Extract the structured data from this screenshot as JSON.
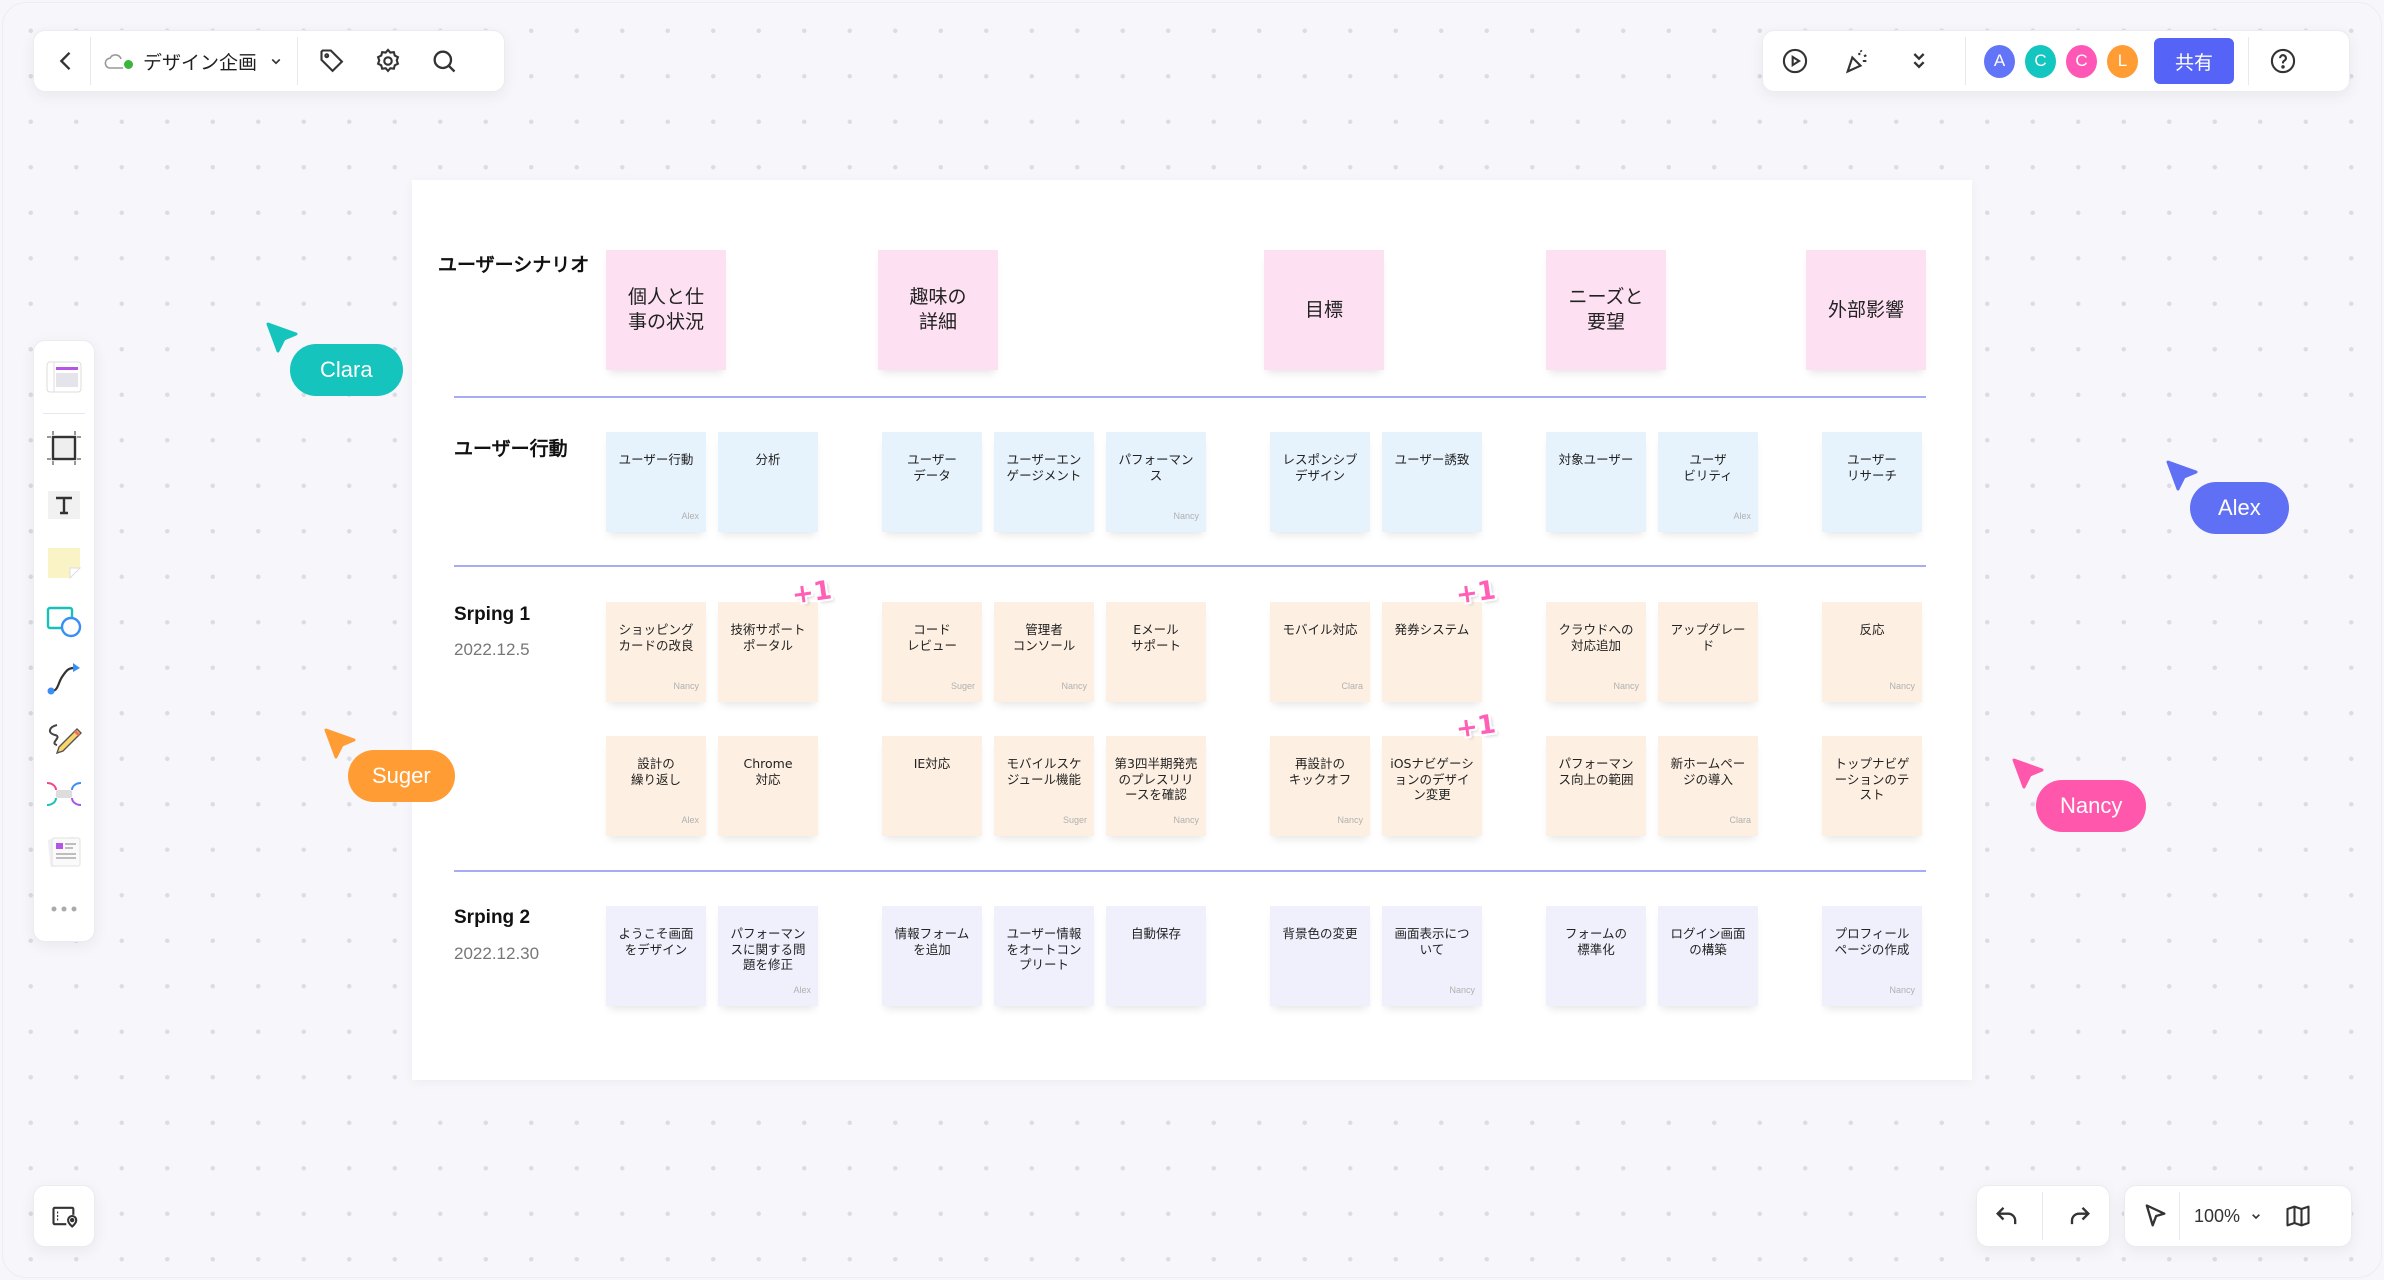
{
  "toolbar": {
    "back_icon": "chevron-left-icon",
    "doc_title": "デザイン企画",
    "sync_status": "synced",
    "icons": [
      "tag-icon",
      "settings-icon",
      "search-icon"
    ]
  },
  "top_right": {
    "icons": [
      "play-icon",
      "celebrate-icon",
      "double-chevron-down-icon",
      "help-icon"
    ],
    "collaborators": [
      {
        "initial": "A",
        "color": "#6274f7"
      },
      {
        "initial": "C",
        "color": "#13c6bf"
      },
      {
        "initial": "C",
        "color": "#ff57b6"
      },
      {
        "initial": "L",
        "color": "#ff9c33"
      }
    ],
    "share_label": "共有",
    "share_color": "#5563f6"
  },
  "left_toolbar": {
    "tools": [
      "template-icon",
      "frame-icon",
      "text-icon",
      "sticky-note-icon",
      "shape-icon",
      "connector-icon",
      "pen-icon",
      "mindmap-icon",
      "document-icon",
      "more-icon"
    ]
  },
  "bottom": {
    "outline_icon": "outline-icon",
    "zoom_level": "100%",
    "icons": [
      "undo-icon",
      "redo-icon",
      "select-cursor-icon",
      "map-icon"
    ]
  },
  "board": {
    "colors": {
      "scenario": "#fde1f3",
      "action": "#e6f3fd",
      "sprint1": "#fdf0e2",
      "sprint2": "#f0f0fd",
      "separator": "#a6abf2"
    },
    "rows": {
      "scenario": {
        "title": "ユーザーシナリオ"
      },
      "action": {
        "title": "ユーザー行動"
      },
      "sprint1": {
        "title": "Srping 1",
        "date": "2022.12.5"
      },
      "sprint2": {
        "title": "Srping 2",
        "date": "2022.12.30"
      }
    },
    "scenario_stickies": [
      {
        "text": "個人と仕\n事の状況"
      },
      {
        "text": "趣味の\n詳細"
      },
      {
        "text": "目標"
      },
      {
        "text": "ニーズと\n要望"
      },
      {
        "text": "外部影響"
      }
    ],
    "action_stickies": [
      {
        "text": "ユーザー行動",
        "author": "Alex"
      },
      {
        "text": "分析",
        "author": ""
      },
      {
        "text": "ユーザー\nデータ",
        "author": ""
      },
      {
        "text": "ユーザーエン\nゲージメント",
        "author": ""
      },
      {
        "text": "パフォーマン\nス",
        "author": "Nancy"
      },
      {
        "text": "レスポンシブ\nデザイン",
        "author": ""
      },
      {
        "text": "ユーザー誘致",
        "author": ""
      },
      {
        "text": "対象ユーザー",
        "author": ""
      },
      {
        "text": "ユーザ\nビリティ",
        "author": "Alex"
      },
      {
        "text": "ユーザー\nリサーチ",
        "author": ""
      }
    ],
    "sprint1_row1": [
      {
        "text": "ショッピング\nカードの改良",
        "author": "Nancy",
        "votes": ""
      },
      {
        "text": "技術サポート\nポータル",
        "author": "",
        "votes": "+1"
      },
      {
        "text": "コード\nレビュー",
        "author": "Suger",
        "votes": ""
      },
      {
        "text": "管理者\nコンソール",
        "author": "Nancy",
        "votes": ""
      },
      {
        "text": "Eメール\nサポート",
        "author": "",
        "votes": ""
      },
      {
        "text": "モバイル対応",
        "author": "Clara",
        "votes": ""
      },
      {
        "text": "発券システム",
        "author": "",
        "votes": "+1"
      },
      {
        "text": "クラウドへの\n対応追加",
        "author": "Nancy",
        "votes": ""
      },
      {
        "text": "アップグレー\nド",
        "author": "",
        "votes": ""
      },
      {
        "text": "反応",
        "author": "Nancy",
        "votes": ""
      }
    ],
    "sprint1_row2": [
      {
        "text": "設計の\n繰り返し",
        "author": "Alex",
        "votes": ""
      },
      {
        "text": "Chrome\n対応",
        "author": "",
        "votes": ""
      },
      {
        "text": "IE対応",
        "author": "",
        "votes": ""
      },
      {
        "text": "モバイルスケ\nジュール機能",
        "author": "Suger",
        "votes": ""
      },
      {
        "text": "第3四半期発売\nのプレスリリ\nースを確認",
        "author": "Nancy",
        "votes": ""
      },
      {
        "text": "再設計の\nキックオフ",
        "author": "Nancy",
        "votes": ""
      },
      {
        "text": "iOSナビゲーシ\nョンのデザイ\nン変更",
        "author": "",
        "votes": "+1"
      },
      {
        "text": "パフォーマン\nス向上の範囲",
        "author": "",
        "votes": ""
      },
      {
        "text": "新ホームペー\nジの導入",
        "author": "Clara",
        "votes": ""
      },
      {
        "text": "トップナビゲ\nーションのテ\nスト",
        "author": "",
        "votes": ""
      }
    ],
    "sprint2_stickies": [
      {
        "text": "ようこそ画面\nをデザイン",
        "author": ""
      },
      {
        "text": "パフォーマン\nスに関する問\n題を修正",
        "author": "Alex"
      },
      {
        "text": "情報フォーム\nを追加",
        "author": ""
      },
      {
        "text": "ユーザー情報\nをオートコン\nプリート",
        "author": ""
      },
      {
        "text": "自動保存",
        "author": ""
      },
      {
        "text": "背景色の変更",
        "author": ""
      },
      {
        "text": "画面表示につ\nいて",
        "author": "Nancy"
      },
      {
        "text": "フォームの\n標準化",
        "author": ""
      },
      {
        "text": "ログイン画面\nの構築",
        "author": ""
      },
      {
        "text": "プロフィール\nページの作成",
        "author": "Nancy"
      }
    ]
  },
  "cursors": [
    {
      "name": "Clara",
      "color": "#14c4bd"
    },
    {
      "name": "Suger",
      "color": "#ff9c33"
    },
    {
      "name": "Alex",
      "color": "#6070f5"
    },
    {
      "name": "Nancy",
      "color": "#ff57ab"
    }
  ]
}
